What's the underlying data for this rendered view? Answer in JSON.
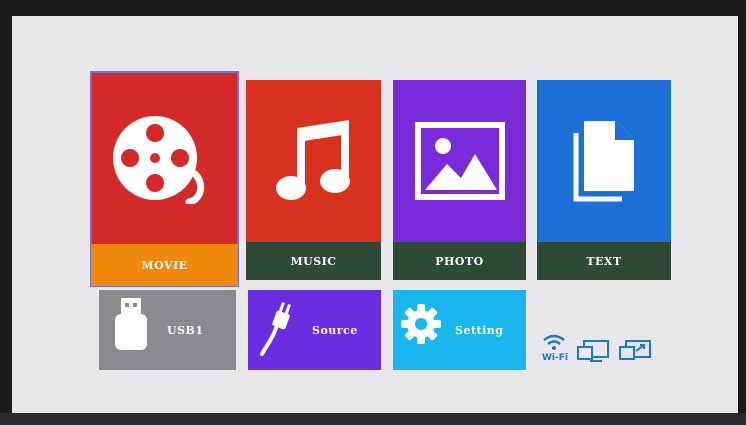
{
  "tiles": {
    "movie": {
      "label": "MOVIE"
    },
    "music": {
      "label": "MUSIC"
    },
    "photo": {
      "label": "PHOTO"
    },
    "text": {
      "label": "TEXT"
    },
    "usb": {
      "label": "USB1"
    },
    "source": {
      "label": "Source"
    },
    "setting": {
      "label": "Setting"
    }
  },
  "status": {
    "wifi_label": "Wi-Fi",
    "icons": [
      "wifi-icon",
      "screen-mirror-icon",
      "screen-share-icon"
    ]
  },
  "colors": {
    "movie": "#d32929",
    "movie_label": "#f08a0c",
    "music": "#d8321f",
    "photo": "#7a2bd9",
    "text": "#1c6fd6",
    "label_bar": "#2c4a36",
    "usb": "#8b8b8f",
    "source": "#6a2ee0",
    "setting": "#1ab7ee",
    "status_icon": "#1b77d4"
  }
}
